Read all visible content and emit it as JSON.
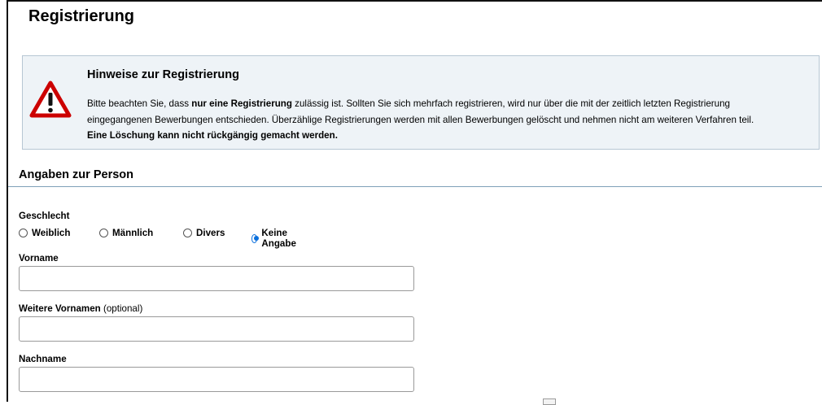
{
  "page": {
    "title": "Registrierung"
  },
  "notice": {
    "title": "Hinweise zur Registrierung",
    "text_part1": "Bitte beachten Sie, dass ",
    "text_bold1": "nur eine Registrierung",
    "text_part2": " zulässig ist. Sollten Sie sich mehrfach registrieren, wird nur über die mit der zeitlich letzten Registrierung eingegangenen Bewerbungen entschieden. Überzählige Registrierungen werden mit allen Bewerbungen gelöscht und nehmen nicht am weiteren Verfahren teil. ",
    "text_bold2": "Eine Löschung kann nicht rückgängig gemacht werden.",
    "icon": "warning-triangle-icon",
    "icon_color": "#cc0000"
  },
  "section": {
    "title": "Angaben zur Person"
  },
  "gender": {
    "label": "Geschlecht",
    "options": [
      "Weiblich",
      "Männlich",
      "Divers",
      "Keine Angabe"
    ],
    "selected": "Keine Angabe"
  },
  "fields": {
    "vorname": {
      "label": "Vorname",
      "value": ""
    },
    "weitere": {
      "label": "Weitere Vornamen",
      "optional": "(optional)",
      "value": ""
    },
    "nachname": {
      "label": "Nachname",
      "value": ""
    }
  },
  "colors": {
    "accent": "#0a6fdc",
    "notice_bg": "#eef3f7",
    "rule": "#7fa0b8"
  }
}
